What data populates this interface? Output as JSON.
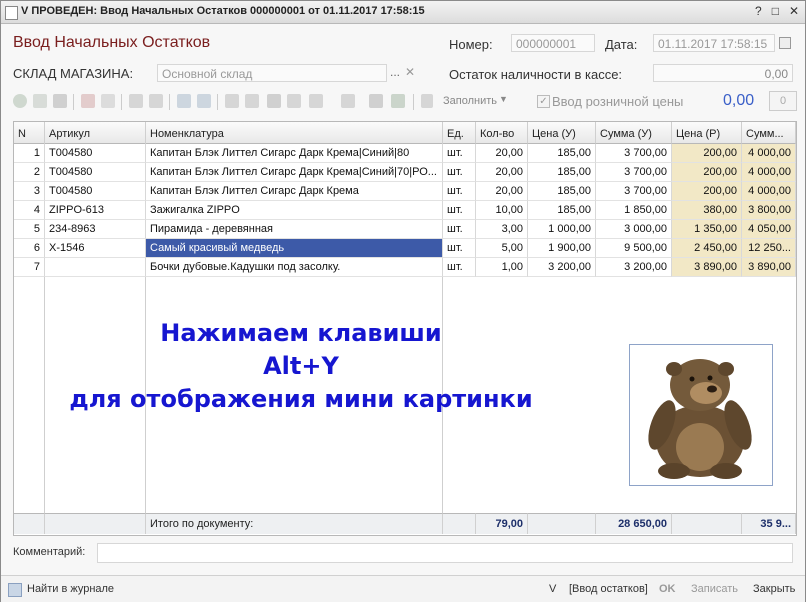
{
  "window": {
    "title": "V ПРОВЕДЕН: Ввод Начальных Остатков 000000001 от 01.11.2017 17:58:15"
  },
  "header": {
    "form_title": "Ввод Начальных Остатков",
    "number_label": "Номер:",
    "number_value": "000000001",
    "date_label": "Дата:",
    "date_value": "01.11.2017 17:58:15",
    "store_label": "СКЛАД МАГАЗИНА:",
    "store_value": "Основной склад",
    "cash_label": "Остаток наличности в кассе:",
    "cash_value": "0,00"
  },
  "toolbar": {
    "fill_label": "Заполнить",
    "retail_label": "Ввод розничной цены",
    "retail_value": "0,00",
    "small_value": "0"
  },
  "table": {
    "columns": [
      "N",
      "Артикул",
      "Номенклатура",
      "Ед.",
      "Кол-во",
      "Цена (У)",
      "Сумма (У)",
      "Цена (Р)",
      "Сумм..."
    ],
    "rows": [
      {
        "n": "1",
        "art": "Т004580",
        "name": "Капитан Блэк Литтел Сигарс Дарк Крема|Синий|80",
        "unit": "шт.",
        "qty": "20,00",
        "price_u": "185,00",
        "sum_u": "3 700,00",
        "price_r": "200,00",
        "sum_r": "4 000,00"
      },
      {
        "n": "2",
        "art": "Т004580",
        "name": "Капитан Блэк Литтел Сигарс Дарк Крема|Синий|70|РО...",
        "unit": "шт.",
        "qty": "20,00",
        "price_u": "185,00",
        "sum_u": "3 700,00",
        "price_r": "200,00",
        "sum_r": "4 000,00"
      },
      {
        "n": "3",
        "art": "Т004580",
        "name": "Капитан Блэк Литтел Сигарс Дарк Крема",
        "unit": "шт.",
        "qty": "20,00",
        "price_u": "185,00",
        "sum_u": "3 700,00",
        "price_r": "200,00",
        "sum_r": "4 000,00"
      },
      {
        "n": "4",
        "art": "ZIPPO-613",
        "name": "Зажигалка ZIPPO",
        "unit": "шт.",
        "qty": "10,00",
        "price_u": "185,00",
        "sum_u": "1 850,00",
        "price_r": "380,00",
        "sum_r": "3 800,00"
      },
      {
        "n": "5",
        "art": "234-8963",
        "name": "Пирамида - деревянная",
        "unit": "шт.",
        "qty": "3,00",
        "price_u": "1 000,00",
        "sum_u": "3 000,00",
        "price_r": "1 350,00",
        "sum_r": "4 050,00"
      },
      {
        "n": "6",
        "art": "X-1546",
        "name": "Самый красивый медведь",
        "unit": "шт.",
        "qty": "5,00",
        "price_u": "1 900,00",
        "sum_u": "9 500,00",
        "price_r": "2 450,00",
        "sum_r": "12 250..."
      },
      {
        "n": "7",
        "art": "",
        "name": "Бочки дубовые.Кадушки под засолку.",
        "unit": "шт.",
        "qty": "1,00",
        "price_u": "3 200,00",
        "sum_u": "3 200,00",
        "price_r": "3 890,00",
        "sum_r": "3 890,00"
      }
    ],
    "footer": {
      "label": "Итого по документу:",
      "qty": "79,00",
      "sum_u": "28 650,00",
      "sum_r": "35 9..."
    }
  },
  "overlay": {
    "line1": "Нажимаем клавиши",
    "line2": "Alt+Y",
    "line3": "для отображения мини картинки"
  },
  "comment": {
    "label": "Комментарий:",
    "value": ""
  },
  "status": {
    "journal": "Найти в журнале",
    "v": "V",
    "mode": "[Ввод остатков]",
    "ok": "OK",
    "save": "Записать",
    "close": "Закрыть"
  }
}
